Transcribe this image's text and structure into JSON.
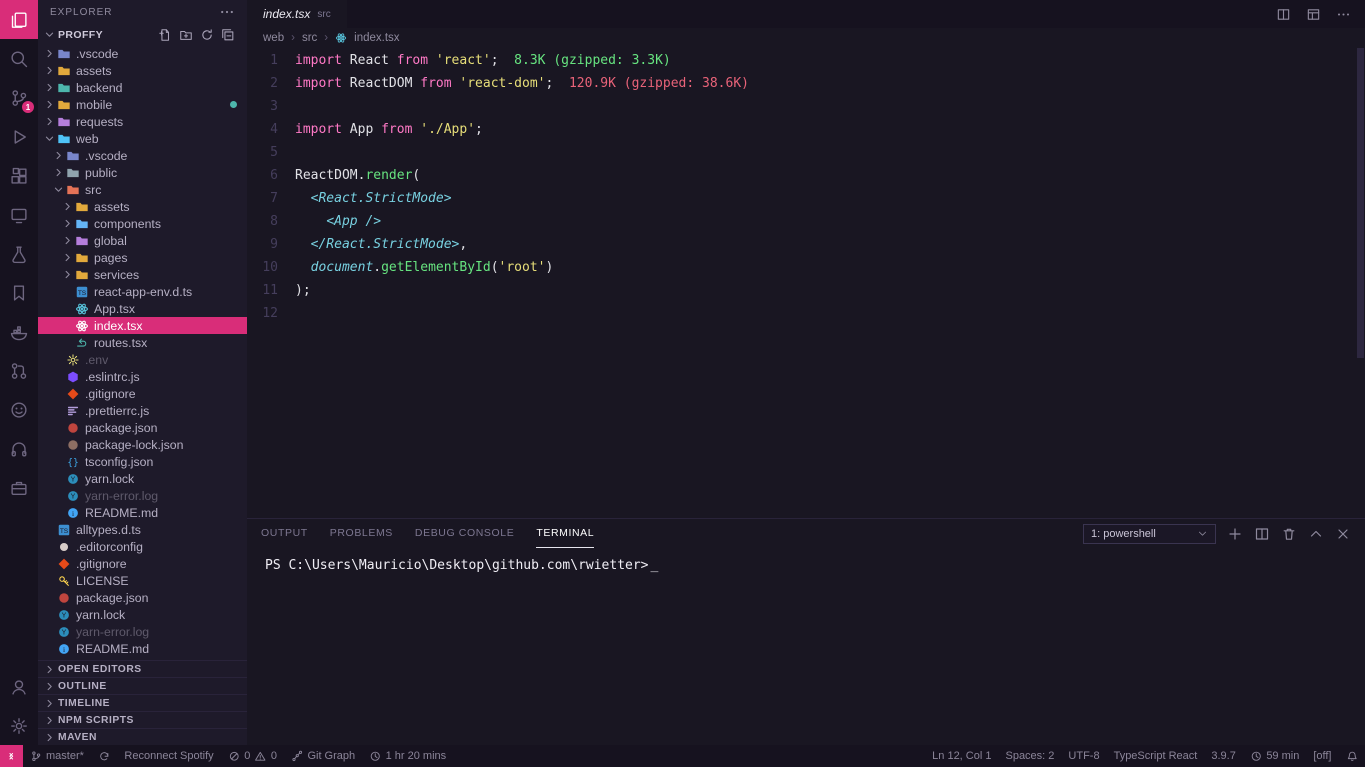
{
  "colors": {
    "accent": "#d92d79",
    "editor_bg": "#191622",
    "sidebar_bg": "#1e1a2a",
    "bar_bg": "#16121f"
  },
  "activity_bar": {
    "top": [
      {
        "name": "explorer",
        "icon": "files",
        "active": true
      },
      {
        "name": "search",
        "icon": "search"
      },
      {
        "name": "source-control",
        "icon": "source-control",
        "badge": "1"
      },
      {
        "name": "run-debug",
        "icon": "debug"
      },
      {
        "name": "extensions",
        "icon": "extensions"
      },
      {
        "name": "remote-explorer",
        "icon": "remote"
      },
      {
        "name": "testing",
        "icon": "testing"
      },
      {
        "name": "bookmarks",
        "icon": "bookmark"
      },
      {
        "name": "docker",
        "icon": "docker"
      },
      {
        "name": "github-pull-requests",
        "icon": "git-pr"
      },
      {
        "name": "gitlens",
        "icon": "face"
      },
      {
        "name": "audio",
        "icon": "headphones"
      },
      {
        "name": "project-manager",
        "icon": "briefcase"
      }
    ],
    "bottom": [
      {
        "name": "accounts",
        "icon": "account"
      },
      {
        "name": "settings",
        "icon": "gear"
      }
    ]
  },
  "sidebar": {
    "title": "EXPLORER",
    "project": "PROFFY",
    "project_actions": [
      "new-file",
      "new-folder",
      "refresh",
      "collapse-all"
    ],
    "tree": [
      {
        "label": ".vscode",
        "depth": 0,
        "icon": "folder",
        "color": "#7986cb",
        "twistie": "chev-r"
      },
      {
        "label": "assets",
        "depth": 0,
        "icon": "folder",
        "color": "#e2a93c",
        "twistie": "chev-r"
      },
      {
        "label": "backend",
        "depth": 0,
        "icon": "folder",
        "color": "#4db6ac",
        "twistie": "chev-r"
      },
      {
        "label": "mobile",
        "depth": 0,
        "icon": "folder",
        "color": "#e2a93c",
        "twistie": "chev-r",
        "dot": "#4db6ac"
      },
      {
        "label": "requests",
        "depth": 0,
        "icon": "folder",
        "color": "#b57edc",
        "twistie": "chev-r"
      },
      {
        "label": "web",
        "depth": 0,
        "icon": "folder",
        "color": "#4fc3f7",
        "twistie": "chev-d"
      },
      {
        "label": ".vscode",
        "depth": 1,
        "icon": "folder",
        "color": "#7986cb",
        "twistie": "chev-r"
      },
      {
        "label": "public",
        "depth": 1,
        "icon": "folder",
        "color": "#90a4ae",
        "twistie": "chev-r"
      },
      {
        "label": "src",
        "depth": 1,
        "icon": "folder",
        "color": "#e57357",
        "twistie": "chev-d"
      },
      {
        "label": "assets",
        "depth": 2,
        "icon": "folder",
        "color": "#e2a93c",
        "twistie": "chev-r"
      },
      {
        "label": "components",
        "depth": 2,
        "icon": "folder",
        "color": "#64b5f6",
        "twistie": "chev-r"
      },
      {
        "label": "global",
        "depth": 2,
        "icon": "folder",
        "color": "#b57edc",
        "twistie": "chev-r"
      },
      {
        "label": "pages",
        "depth": 2,
        "icon": "folder",
        "color": "#e2a93c",
        "twistie": "chev-r"
      },
      {
        "label": "services",
        "depth": 2,
        "icon": "folder",
        "color": "#e2a93c",
        "twistie": "chev-r"
      },
      {
        "label": "react-app-env.d.ts",
        "depth": 2,
        "icon": "ts",
        "color": "#3d8fd1"
      },
      {
        "label": "App.tsx",
        "depth": 2,
        "icon": "react",
        "color": "#58c4dc"
      },
      {
        "label": "index.tsx",
        "depth": 2,
        "icon": "react",
        "color": "#ffffff",
        "selected": true
      },
      {
        "label": "routes.tsx",
        "depth": 2,
        "icon": "routing",
        "color": "#4db6ac"
      },
      {
        "label": ".env",
        "depth": 1,
        "icon": "gear",
        "color": "#e7de79",
        "dimmed": true
      },
      {
        "label": ".eslintrc.js",
        "depth": 1,
        "icon": "eslint",
        "color": "#7c4dff"
      },
      {
        "label": ".gitignore",
        "depth": 1,
        "icon": "git",
        "color": "#e64a19"
      },
      {
        "label": ".prettierrc.js",
        "depth": 1,
        "icon": "prettier",
        "color": "#b39ddb"
      },
      {
        "label": "package.json",
        "depth": 1,
        "icon": "npm",
        "color": "#c0453e"
      },
      {
        "label": "package-lock.json",
        "depth": 1,
        "icon": "npm",
        "color": "#8d6e63"
      },
      {
        "label": "tsconfig.json",
        "depth": 1,
        "icon": "braces",
        "color": "#3da4e3"
      },
      {
        "label": "yarn.lock",
        "depth": 1,
        "icon": "yarn",
        "color": "#2c8ebb"
      },
      {
        "label": "yarn-error.log",
        "depth": 1,
        "icon": "yarn",
        "color": "#2c8ebb",
        "dimmed": true
      },
      {
        "label": "README.md",
        "depth": 1,
        "icon": "info",
        "color": "#42a5f5"
      },
      {
        "label": "alltypes.d.ts",
        "depth": 0,
        "icon": "ts",
        "color": "#3d8fd1"
      },
      {
        "label": ".editorconfig",
        "depth": 0,
        "icon": "dot",
        "color": "#d7ccc8"
      },
      {
        "label": ".gitignore",
        "depth": 0,
        "icon": "git",
        "color": "#e64a19"
      },
      {
        "label": "LICENSE",
        "depth": 0,
        "icon": "key",
        "color": "#ffd54f"
      },
      {
        "label": "package.json",
        "depth": 0,
        "icon": "npm",
        "color": "#c0453e"
      },
      {
        "label": "yarn.lock",
        "depth": 0,
        "icon": "yarn",
        "color": "#2c8ebb"
      },
      {
        "label": "yarn-error.log",
        "depth": 0,
        "icon": "yarn",
        "color": "#2c8ebb",
        "dimmed": true
      },
      {
        "label": "README.md",
        "depth": 0,
        "icon": "info",
        "color": "#42a5f5"
      }
    ],
    "sections": [
      "OPEN EDITORS",
      "OUTLINE",
      "TIMELINE",
      "NPM SCRIPTS",
      "MAVEN"
    ]
  },
  "editor": {
    "tab": {
      "label": "index.tsx",
      "detail": "src"
    },
    "tab_actions": [
      "split",
      "layout",
      "more"
    ],
    "breadcrumb": [
      "web",
      "src",
      "index.tsx"
    ],
    "lines": [
      {
        "tokens": [
          [
            "kw",
            "import"
          ],
          [
            "pl",
            " React "
          ],
          [
            "kw",
            "from"
          ],
          [
            "pl",
            " "
          ],
          [
            "str",
            "'react'"
          ],
          [
            "pl",
            ";"
          ],
          [
            "ok",
            "  8.3K (gzipped: 3.3K)"
          ]
        ]
      },
      {
        "tokens": [
          [
            "kw",
            "import"
          ],
          [
            "pl",
            " ReactDOM "
          ],
          [
            "kw",
            "from"
          ],
          [
            "pl",
            " "
          ],
          [
            "str",
            "'react-dom'"
          ],
          [
            "pl",
            ";"
          ],
          [
            "bad",
            "  120.9K (gzipped: 38.6K)"
          ]
        ]
      },
      {
        "tokens": []
      },
      {
        "tokens": [
          [
            "kw",
            "import"
          ],
          [
            "pl",
            " App "
          ],
          [
            "kw",
            "from"
          ],
          [
            "pl",
            " "
          ],
          [
            "str",
            "'./App'"
          ],
          [
            "pl",
            ";"
          ]
        ]
      },
      {
        "tokens": []
      },
      {
        "tokens": [
          [
            "pl",
            "ReactDOM."
          ],
          [
            "fn",
            "render"
          ],
          [
            "pl",
            "("
          ]
        ]
      },
      {
        "tokens": [
          [
            "pl",
            "  "
          ],
          [
            "tag",
            "<React.StrictMode>"
          ]
        ]
      },
      {
        "tokens": [
          [
            "pl",
            "    "
          ],
          [
            "tag",
            "<App />"
          ]
        ]
      },
      {
        "tokens": [
          [
            "pl",
            "  "
          ],
          [
            "tag",
            "</React.StrictMode>"
          ],
          [
            "pl",
            ","
          ]
        ]
      },
      {
        "tokens": [
          [
            "pl",
            "  "
          ],
          [
            "obj",
            "document"
          ],
          [
            "pl",
            "."
          ],
          [
            "fn",
            "getElementById"
          ],
          [
            "pl",
            "("
          ],
          [
            "str",
            "'root'"
          ],
          [
            "pl",
            ")"
          ]
        ]
      },
      {
        "tokens": [
          [
            "pl",
            ");"
          ]
        ]
      },
      {
        "tokens": []
      }
    ]
  },
  "panel": {
    "tabs": [
      {
        "label": "OUTPUT",
        "active": false
      },
      {
        "label": "PROBLEMS",
        "active": false
      },
      {
        "label": "DEBUG CONSOLE",
        "active": false
      },
      {
        "label": "TERMINAL",
        "active": true
      }
    ],
    "shell_select": "1: powershell",
    "action_icons": [
      "plus",
      "split",
      "trash",
      "chev-u",
      "close"
    ],
    "terminal_prompt": "PS C:\\Users\\Mauricio\\Desktop\\github.com\\rwietter>",
    "terminal_cursor": "_"
  },
  "status_bar": {
    "left": [
      {
        "name": "remote-indicator",
        "accent": true,
        "parts": [
          [
            "icon",
            "remote-ind"
          ]
        ]
      },
      {
        "name": "git-branch",
        "parts": [
          [
            "icon",
            "branch"
          ],
          [
            "text",
            "master*"
          ]
        ]
      },
      {
        "name": "sync",
        "parts": [
          [
            "icon",
            "sync"
          ]
        ]
      },
      {
        "name": "spotify-reconnect",
        "parts": [
          [
            "text",
            "Reconnect Spotify"
          ]
        ]
      },
      {
        "name": "problems",
        "parts": [
          [
            "icon",
            "error"
          ],
          [
            "text",
            "0"
          ],
          [
            "icon",
            "warning"
          ],
          [
            "text",
            "0"
          ]
        ]
      },
      {
        "name": "git-graph",
        "parts": [
          [
            "icon",
            "graph"
          ],
          [
            "text",
            "Git Graph"
          ]
        ]
      },
      {
        "name": "time-tracker",
        "parts": [
          [
            "icon",
            "clock"
          ],
          [
            "text",
            "1 hr 20 mins"
          ]
        ]
      }
    ],
    "right": [
      {
        "name": "cursor-position",
        "parts": [
          [
            "text",
            "Ln 12, Col 1"
          ]
        ]
      },
      {
        "name": "indentation",
        "parts": [
          [
            "text",
            "Spaces: 2"
          ]
        ]
      },
      {
        "name": "encoding",
        "parts": [
          [
            "text",
            "UTF-8"
          ]
        ]
      },
      {
        "name": "language-mode",
        "parts": [
          [
            "text",
            "TypeScript React"
          ]
        ]
      },
      {
        "name": "ts-version",
        "parts": [
          [
            "text",
            "3.9.7"
          ]
        ]
      },
      {
        "name": "timer",
        "parts": [
          [
            "icon",
            "clock"
          ],
          [
            "text",
            "59 min"
          ]
        ]
      },
      {
        "name": "toggle-off",
        "parts": [
          [
            "text",
            "[off]"
          ]
        ]
      },
      {
        "name": "notifications",
        "parts": [
          [
            "icon",
            "bell"
          ]
        ]
      }
    ]
  }
}
